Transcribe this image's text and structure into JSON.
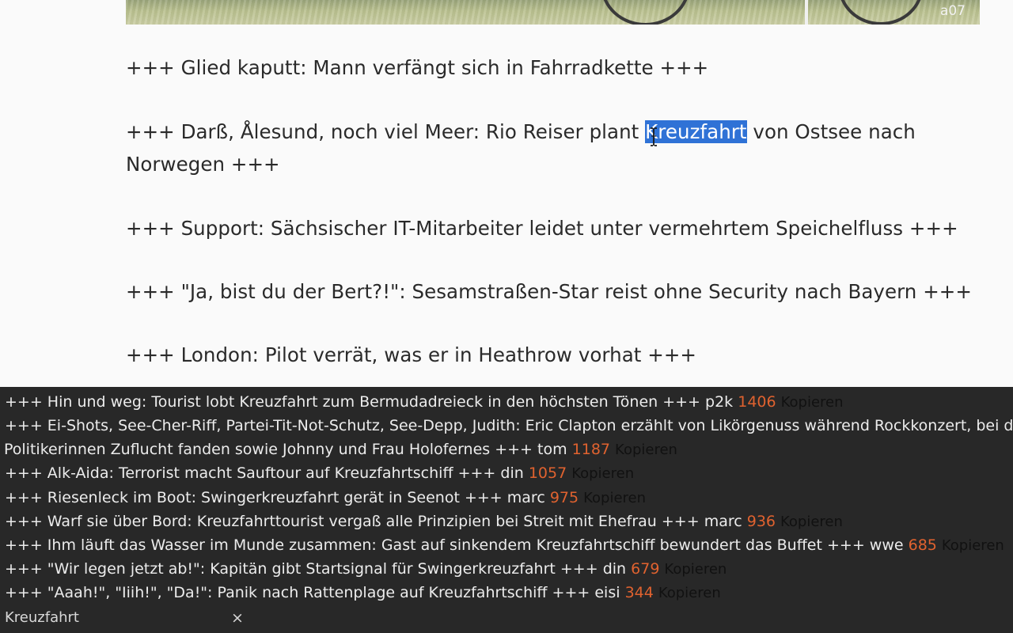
{
  "article": {
    "image_credit": "a07",
    "headlines": [
      "+++ Glied kaputt: Mann verfängt sich in Fahrradkette +++",
      {
        "before": "+++ Darß, Ålesund, noch viel Meer: Rio Reiser plant ",
        "selected": "Kreuzfahrt",
        "after": " von Ostsee nach Norwegen +++"
      },
      "+++ Support: Sächsischer IT-Mitarbeiter leidet unter vermehrtem Speichelfluss +++",
      "+++ \"Ja, bist du der Bert?!\": Sesamstraßen-Star reist ohne Security nach Bayern +++",
      "+++ London: Pilot verrät, was er in Heathrow vorhat +++"
    ]
  },
  "results": {
    "copy_label": "Kopieren",
    "accent_color": "#e0622f",
    "items": [
      {
        "text": "+++ Hin und weg: Tourist lobt Kreuzfahrt zum Bermudadreieck in den höchsten Tönen +++",
        "author": "p2k",
        "count": "1406"
      },
      {
        "text": "+++ Ei-Shots, See-Cher-Riff, Partei-Tit-Not-Schutz, See-Depp, Judith: Eric Clapton erzählt von Likörgenuss während Rockkonzert, bei dem",
        "text_line2": "Politikerinnen Zuflucht fanden sowie Johnny und Frau Holofernes +++",
        "author": "tom",
        "count": "1187"
      },
      {
        "text": "+++ Alk-Aida: Terrorist macht Sauftour auf Kreuzfahrtschiff +++",
        "author": "din",
        "count": "1057"
      },
      {
        "text": "+++ Riesenleck im Boot: Swingerkreuzfahrt gerät in Seenot +++",
        "author": "marc",
        "count": "975"
      },
      {
        "text": "+++ Warf sie über Bord: Kreuzfahrttourist vergaß alle Prinzipien bei Streit mit Ehefrau +++",
        "author": "marc",
        "count": "936"
      },
      {
        "text": "+++ Ihm läuft das Wasser im Munde zusammen: Gast auf sinkendem Kreuzfahrtschiff bewundert das Buffet +++",
        "author": "wwe",
        "count": "685"
      },
      {
        "text": "+++ \"Wir legen jetzt ab!\": Kapitän gibt Startsignal für Swingerkreuzfahrt +++",
        "author": "din",
        "count": "679"
      },
      {
        "text": "+++ \"Aaah!\", \"Iiih!\", \"Da!\": Panik nach Rattenplage auf Kreuzfahrtschiff +++",
        "author": "eisi",
        "count": "344"
      }
    ]
  },
  "search": {
    "term": "Kreuzfahrt",
    "clear_icon": "×"
  }
}
